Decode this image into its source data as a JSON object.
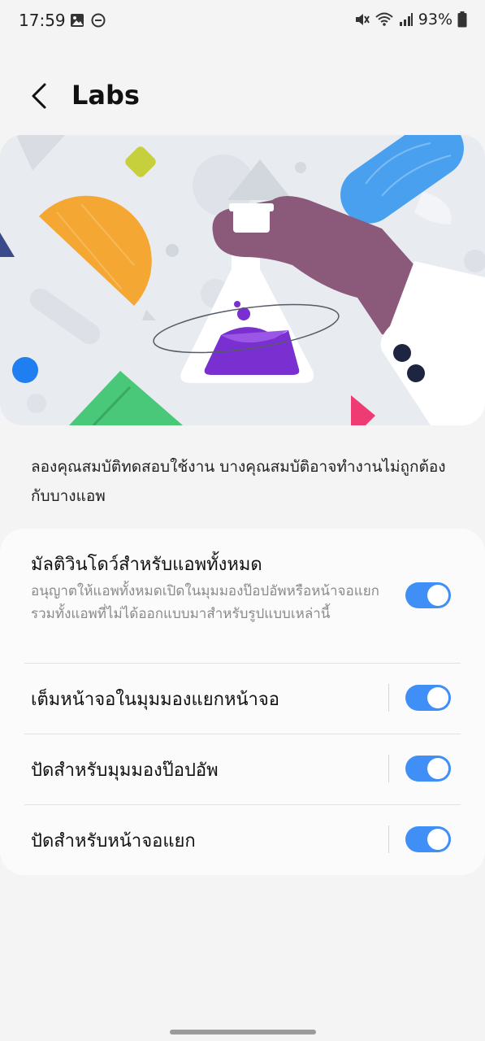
{
  "status_bar": {
    "time": "17:59",
    "battery": "93%"
  },
  "header": {
    "title": "Labs"
  },
  "description": "ลองคุณสมบัติทดสอบใช้งาน บางคุณสมบัติอาจทำงานไม่ถูกต้องกับบางแอพ",
  "settings": [
    {
      "title": "มัลติวินโดว์สำหรับแอพทั้งหมด",
      "summary": "อนุญาตให้แอพทั้งหมดเปิดในมุมมองป๊อปอัพหรือหน้าจอแยก รวมทั้งแอพที่ไม่ได้ออกแบบมาสำหรับรูปแบบเหล่านี้",
      "enabled": true
    },
    {
      "title": "เต็มหน้าจอในมุมมองแยกหน้าจอ",
      "enabled": true
    },
    {
      "title": "ปัดสำหรับมุมมองป๊อปอัพ",
      "enabled": true
    },
    {
      "title": "ปัดสำหรับหน้าจอแยก",
      "enabled": true
    }
  ],
  "colors": {
    "toggle_on": "#3f8ff7",
    "background": "#f4f4f4",
    "card": "#fbfbfb",
    "hero_bg": "#e8ebf0"
  }
}
